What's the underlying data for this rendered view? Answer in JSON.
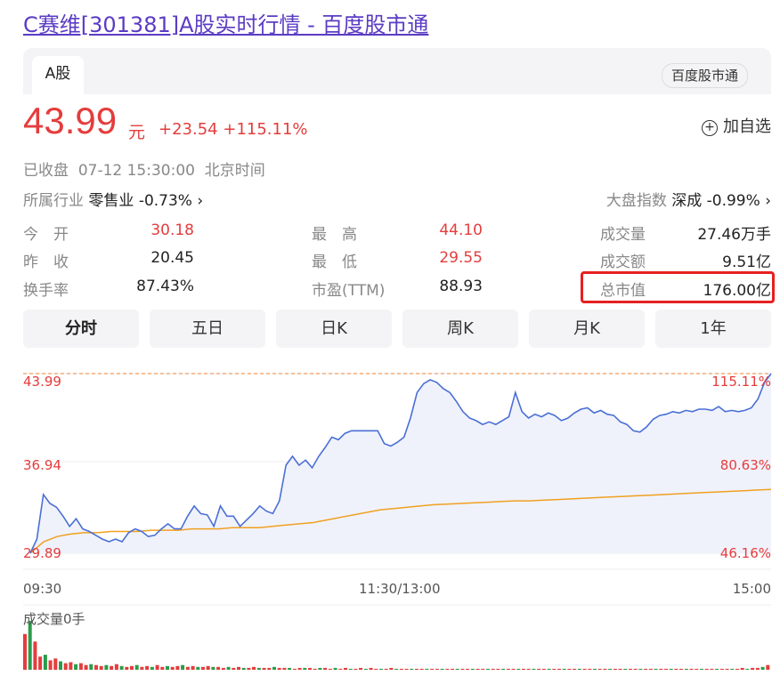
{
  "page": {
    "title": "C赛维[301381]A股实时行情 - 百度股市通"
  },
  "tabs": {
    "active": "A股",
    "source_badge": "百度股市通"
  },
  "quote": {
    "price": "43.99",
    "unit": "元",
    "change": "+23.54",
    "change_pct": "+115.11%",
    "add_watchlist": "加自选",
    "status": "已收盘",
    "datetime": "07-12 15:30:00",
    "timezone": "北京时间",
    "industry_label": "所属行业",
    "industry_name": "零售业",
    "industry_change": "-0.73%",
    "index_label": "大盘指数",
    "index_name": "深成",
    "index_change": "-0.99%"
  },
  "stats": {
    "open_label": "今　开",
    "open": "30.18",
    "prev_close_label": "昨　收",
    "prev_close": "20.45",
    "turnover_label": "换手率",
    "turnover": "87.43%",
    "high_label": "最　高",
    "high": "44.10",
    "low_label": "最　低",
    "low": "29.55",
    "pe_label": "市盈(TTM)",
    "pe": "88.93",
    "volume_label": "成交量",
    "volume": "27.46万手",
    "amount_label": "成交额",
    "amount": "9.51亿",
    "mcap_label": "总市值",
    "mcap": "176.00亿"
  },
  "periods": [
    "分时",
    "五日",
    "日K",
    "周K",
    "月K",
    "1年"
  ],
  "active_period": "分时",
  "colors": {
    "up": "#e43d3d",
    "price_line": "#4a6fd6",
    "avg_line": "#f0a020",
    "fill": "#eef1fb",
    "down": "#2a9d4a"
  },
  "chart_data": {
    "type": "line",
    "x_labels": [
      "09:30",
      "11:30/13:00",
      "15:00"
    ],
    "y_labels_left": [
      "43.99",
      "36.94",
      "29.89"
    ],
    "y_labels_right": [
      "115.11%",
      "80.63%",
      "46.16%"
    ],
    "ylim": [
      29.89,
      43.99
    ],
    "volume_label": "成交量0手",
    "series": [
      {
        "values": [
          29.9,
          31.0,
          34.5,
          33.8,
          33.5,
          32.8,
          32.0,
          32.6,
          31.8,
          31.6,
          31.3,
          31.0,
          30.8,
          31.0,
          30.8,
          31.5,
          31.8,
          31.6,
          31.2,
          31.3,
          31.8,
          32.2,
          31.8,
          31.8,
          32.8,
          33.6,
          33.0,
          32.9,
          32.0,
          33.6,
          32.8,
          32.8,
          32.0,
          32.5,
          33.0,
          33.6,
          33.2,
          33.0,
          34.0,
          36.8,
          37.5,
          36.8,
          37.2,
          36.6,
          37.5,
          38.2,
          39.0,
          38.8,
          39.3,
          39.5,
          39.5,
          39.5,
          39.5,
          39.5,
          38.5,
          38.3,
          38.6,
          39.0,
          40.5,
          42.5,
          43.2,
          43.5,
          43.3,
          42.8,
          42.5,
          41.8,
          41.0,
          40.5,
          40.3,
          40.0,
          40.2,
          40.0,
          40.3,
          40.6,
          42.5,
          41.0,
          40.5,
          40.8,
          40.6,
          40.9,
          40.7,
          40.3,
          40.5,
          40.9,
          41.2,
          41.3,
          40.9,
          41.1,
          40.8,
          40.7,
          40.2,
          40.0,
          39.5,
          39.4,
          39.8,
          40.4,
          40.7,
          40.8,
          41.0,
          40.9,
          41.1,
          41.0,
          41.2,
          41.2,
          41.1,
          41.4,
          41.0,
          41.1,
          41.0,
          41.1,
          41.3,
          42.0,
          43.3,
          43.99
        ]
      },
      {
        "values": [
          29.9,
          30.8,
          31.2,
          31.4,
          31.5,
          31.5,
          31.6,
          31.6,
          31.6,
          31.7,
          31.7,
          31.7,
          31.8,
          31.8,
          31.8,
          31.9,
          31.9,
          31.9,
          32.0,
          32.1,
          32.2,
          32.3,
          32.5,
          32.7,
          32.9,
          33.1,
          33.3,
          33.4,
          33.5,
          33.6,
          33.7,
          33.75,
          33.8,
          33.85,
          33.9,
          33.95,
          34.0,
          34.0,
          34.05,
          34.1,
          34.15,
          34.2,
          34.25,
          34.3,
          34.35,
          34.4,
          34.45,
          34.5,
          34.55,
          34.6,
          34.65,
          34.7,
          34.75,
          34.8,
          34.85,
          34.9
        ]
      }
    ],
    "volume_bars": [
      38,
      52,
      30,
      14,
      16,
      10,
      12,
      9,
      7,
      8,
      6,
      7,
      5,
      6,
      5,
      4,
      5,
      4,
      6,
      4,
      3,
      4,
      5,
      3,
      4,
      3,
      5,
      3,
      4,
      3,
      4,
      5,
      3,
      4,
      3,
      3,
      4,
      3,
      3,
      2,
      3,
      2,
      3,
      2,
      2,
      3,
      2,
      2,
      2,
      3,
      2,
      2,
      2,
      1,
      2,
      2,
      2,
      1,
      2,
      2,
      1,
      2,
      1,
      2,
      1,
      1,
      2,
      1,
      2,
      1,
      1,
      1,
      2,
      1,
      1,
      1,
      1,
      1,
      1,
      1,
      1,
      1,
      1,
      1,
      1,
      1,
      1,
      1,
      1,
      1,
      1,
      1,
      1,
      1,
      1,
      1,
      1,
      1,
      1,
      1,
      1,
      1,
      1,
      1,
      1,
      1,
      1,
      1,
      1,
      1,
      1,
      1,
      1,
      1,
      1,
      1,
      1,
      1,
      1,
      1,
      1,
      1,
      1,
      1,
      1,
      1,
      1,
      1,
      1,
      1,
      1,
      1,
      1,
      1,
      1,
      1,
      1,
      1,
      1,
      1,
      1,
      2,
      1,
      2,
      2,
      3,
      5
    ]
  }
}
